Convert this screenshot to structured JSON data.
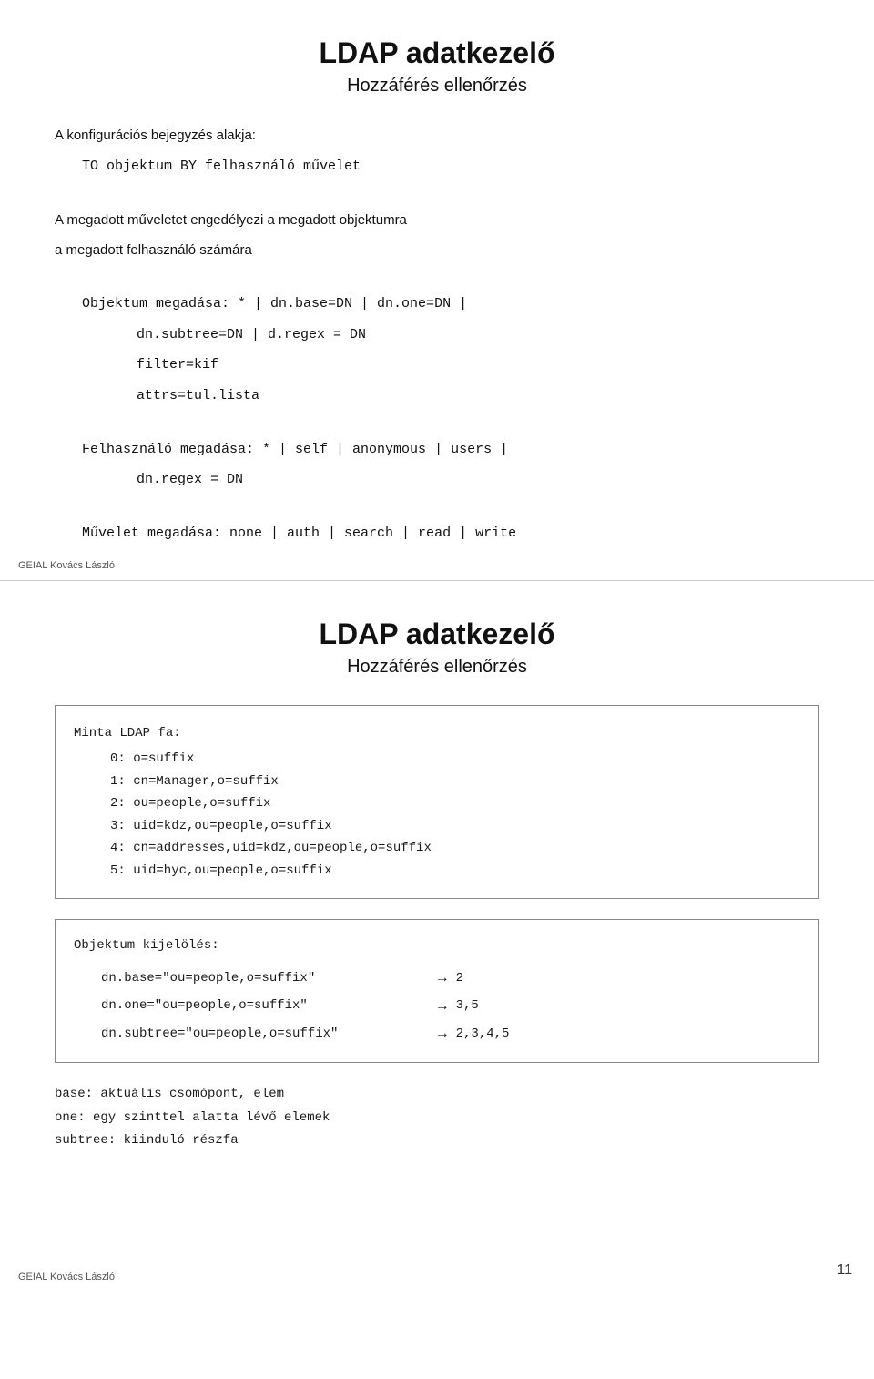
{
  "top_slide": {
    "title": "LDAP adatkezelő",
    "subtitle": "Hozzáférés ellenőrzés",
    "intro_line1": "A konfigurációs bejegyzés alakja:",
    "intro_line2": "TO objektum BY felhasználó művelet",
    "desc_line1": "A megadott műveletet engedélyezi a megadott objektumra",
    "desc_line2": "a megadott felhasználó számára",
    "objektum_label": "Objektum megadása: * |  dn.base=DN  |  dn.one=DN  |",
    "objektum_line2": "dn.subtree=DN  |  d.regex = DN",
    "objektum_line3": "filter=kif",
    "objektum_line4": "attrs=tul.lista",
    "felh_label": "Felhasználó megadása: * |  self  |  anonymous  |  users  |",
    "felh_line2": "dn.regex = DN",
    "muvelet_label": "Művelet megadása: none  |  auth  |  search  |  read  |  write",
    "credit": "GEIAL Kovács László"
  },
  "bottom_slide": {
    "title": "LDAP adatkezelő",
    "subtitle": "Hozzáférés ellenőrzés",
    "minta_label": "Minta LDAP fa:",
    "minta_items": [
      "0: o=suffix",
      "1: cn=Manager,o=suffix",
      "2: ou=people,o=suffix",
      "3: uid=kdz,ou=people,o=suffix",
      "4: cn=addresses,uid=kdz,ou=people,o=suffix",
      "5: uid=hyc,ou=people,o=suffix"
    ],
    "objektum_label": "Objektum kijelölés:",
    "obj_rows": [
      {
        "query": "dn.base=\"ou=people,o=suffix\"",
        "arrow": "→",
        "result": "2"
      },
      {
        "query": "dn.one=\"ou=people,o=suffix\"",
        "arrow": "→",
        "result": "3,5"
      },
      {
        "query": "dn.subtree=\"ou=people,o=suffix\"",
        "arrow": "→",
        "result": "2,3,4,5"
      }
    ],
    "notes": [
      "base: aktuális csomópont, elem",
      "one: egy szinttel alatta lévő elemek",
      "subtree: kiinduló részfa"
    ],
    "credit": "GEIAL Kovács László",
    "page_number": "11"
  }
}
